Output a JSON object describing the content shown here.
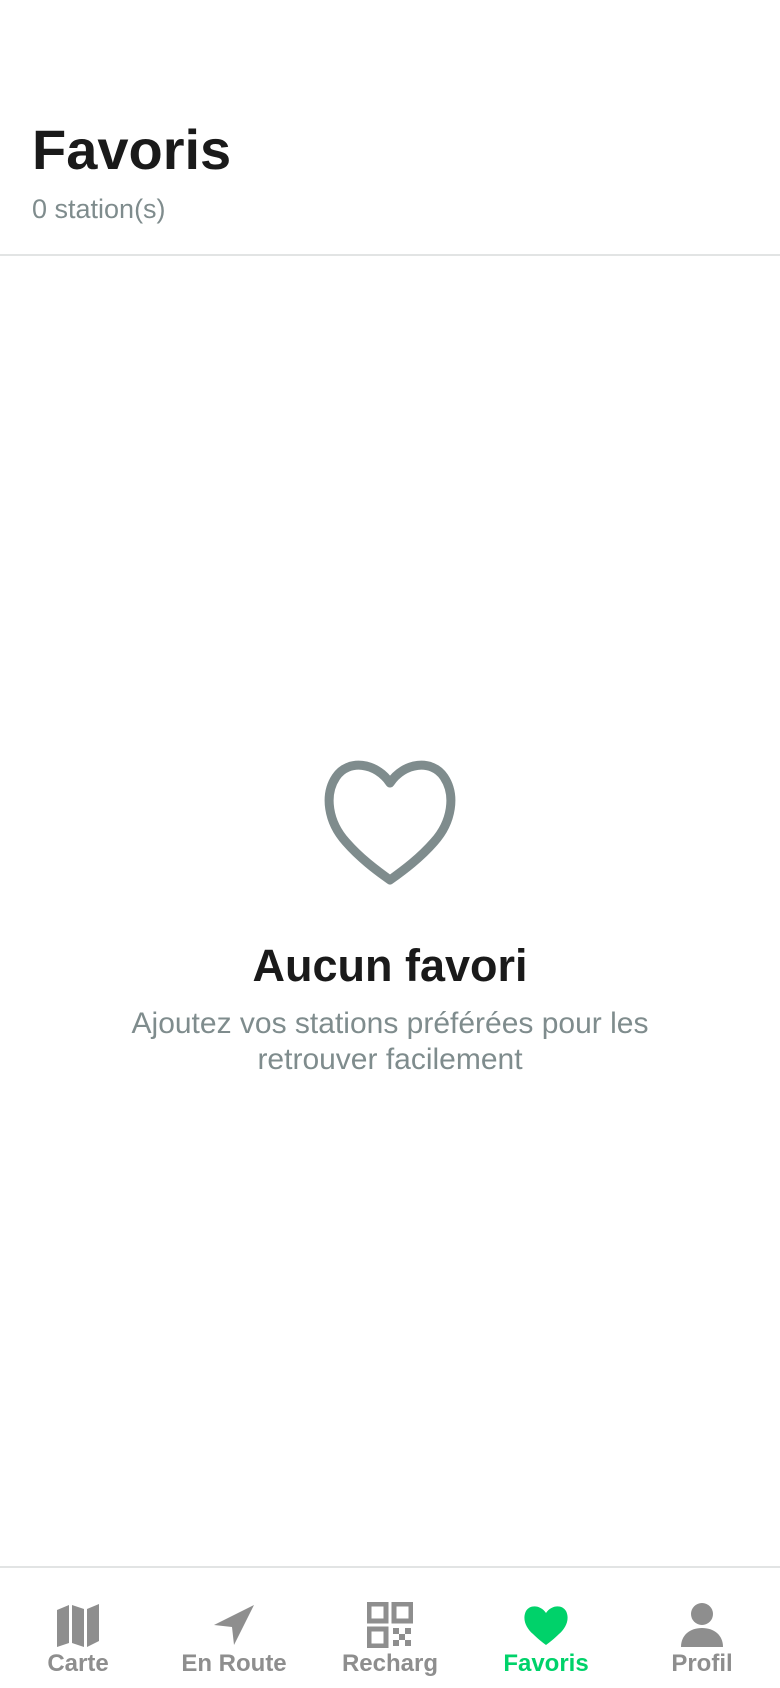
{
  "header": {
    "title": "Favoris",
    "subtitle": "0 station(s)"
  },
  "empty_state": {
    "icon": "heart-outline-icon",
    "title": "Aucun favori",
    "description": "Ajoutez vos stations préférées pour les retrouver facilement"
  },
  "tabbar": {
    "active_tab": "Favoris",
    "tabs": [
      {
        "label": "Carte",
        "icon": "map-icon"
      },
      {
        "label": "En Route",
        "icon": "navigation-arrow-icon"
      },
      {
        "label": "Recharg",
        "icon": "qr-code-icon"
      },
      {
        "label": "Favoris",
        "icon": "heart-icon"
      },
      {
        "label": "Profil",
        "icon": "person-icon"
      }
    ]
  },
  "colors": {
    "accent": "#00d26a",
    "text_primary": "#1a1a1a",
    "text_secondary": "#7f8c8d",
    "tab_inactive": "#8e8e8e",
    "divider": "#e2e4e4",
    "empty_icon": "#7f8c8d"
  }
}
